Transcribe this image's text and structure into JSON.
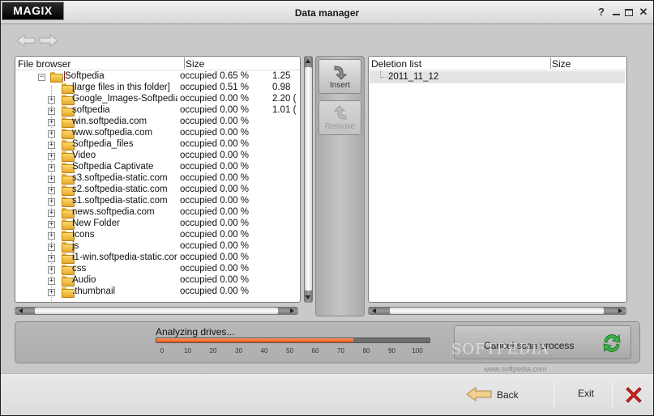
{
  "app": {
    "logo": "MAGIX",
    "title": "Data manager"
  },
  "window_controls": {
    "help": "?",
    "minimize": "▭",
    "maximize": "☐",
    "close": "✕"
  },
  "file_browser": {
    "col_name": "File browser",
    "col_size": "Size",
    "rows": [
      {
        "name": "Softpedia",
        "occupied": "occupied 0.65 %",
        "size": "1.25"
      },
      {
        "name": "[large files in this folder]",
        "occupied": "occupied 0.51 %",
        "size": "0.98"
      },
      {
        "name": "Google_Images-Softpedia",
        "occupied": "occupied 0.00 %",
        "size": "2.20 ("
      },
      {
        "name": "softpedia",
        "occupied": "occupied 0.00 %",
        "size": "1.01 ("
      },
      {
        "name": "win.softpedia.com",
        "occupied": "occupied 0.00 %",
        "size": ""
      },
      {
        "name": "www.softpedia.com",
        "occupied": "occupied 0.00 %",
        "size": ""
      },
      {
        "name": "Softpedia_files",
        "occupied": "occupied 0.00 %",
        "size": ""
      },
      {
        "name": "Video",
        "occupied": "occupied 0.00 %",
        "size": ""
      },
      {
        "name": "Softpedia Captivate",
        "occupied": "occupied 0.00 %",
        "size": ""
      },
      {
        "name": "s3.softpedia-static.com",
        "occupied": "occupied 0.00 %",
        "size": ""
      },
      {
        "name": "s2.softpedia-static.com",
        "occupied": "occupied 0.00 %",
        "size": ""
      },
      {
        "name": "s1.softpedia-static.com",
        "occupied": "occupied 0.00 %",
        "size": ""
      },
      {
        "name": "news.softpedia.com",
        "occupied": "occupied 0.00 %",
        "size": ""
      },
      {
        "name": "New Folder",
        "occupied": "occupied 0.00 %",
        "size": ""
      },
      {
        "name": "Icons",
        "occupied": "occupied 0.00 %",
        "size": ""
      },
      {
        "name": "js",
        "occupied": "occupied 0.00 %",
        "size": ""
      },
      {
        "name": "i1-win.softpedia-static.com",
        "occupied": "occupied 0.00 %",
        "size": ""
      },
      {
        "name": "css",
        "occupied": "occupied 0.00 %",
        "size": ""
      },
      {
        "name": "Audio",
        "occupied": "occupied 0.00 %",
        "size": ""
      },
      {
        "name": ".thumbnail",
        "occupied": "occupied 0.00 %",
        "size": ""
      }
    ]
  },
  "middle": {
    "insert_label": "Insert",
    "remove_label": "Remove"
  },
  "deletion_list": {
    "col_name": "Deletion list",
    "col_size": "Size",
    "items": [
      {
        "name": "2011_11_12"
      }
    ]
  },
  "status": {
    "text": "Analyzing drives...",
    "progress_percent": 72,
    "ticks": [
      "0",
      "10",
      "20",
      "30",
      "40",
      "50",
      "60",
      "70",
      "80",
      "90",
      "100"
    ],
    "cancel_label": "Cancel scan process"
  },
  "watermark": {
    "text": "SOFTPEDIA",
    "url": "www.softpedia.com"
  },
  "footer": {
    "back_label": "Back",
    "exit_label": "Exit"
  },
  "colors": {
    "progress": "#e0521a",
    "close_x": "#e02020",
    "refresh": "#3bb54a"
  }
}
